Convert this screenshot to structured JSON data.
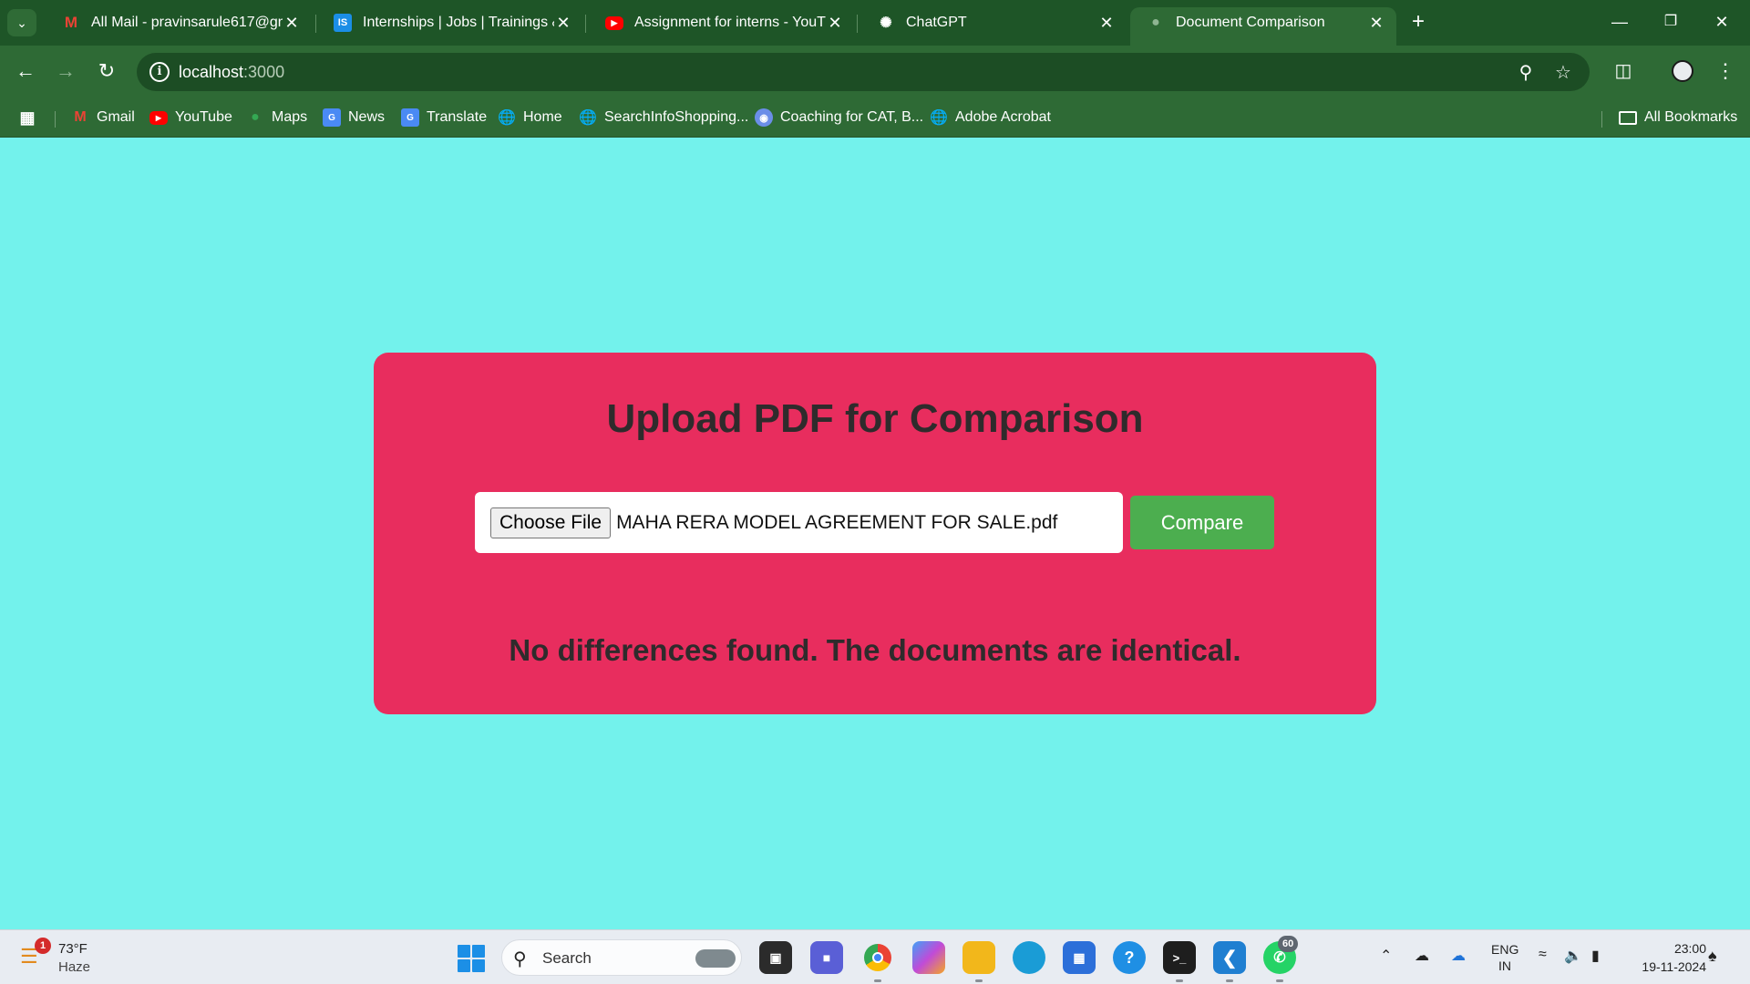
{
  "browser": {
    "tabs": [
      {
        "title": "All Mail - pravinsarule617@gma",
        "favicon": "gmail-icon"
      },
      {
        "title": "Internships | Jobs | Trainings & I",
        "favicon": "internshala-icon"
      },
      {
        "title": "Assignment for interns - YouTub",
        "favicon": "youtube-icon"
      },
      {
        "title": "ChatGPT",
        "favicon": "chatgpt-icon"
      },
      {
        "title": "Document Comparison",
        "favicon": "globe-icon",
        "active": true
      }
    ],
    "address": {
      "host": "localhost",
      "port": ":3000"
    },
    "bookmarks": [
      {
        "label": "Gmail",
        "icon": "gmail-icon"
      },
      {
        "label": "YouTube",
        "icon": "youtube-icon"
      },
      {
        "label": "Maps",
        "icon": "maps-icon"
      },
      {
        "label": "News",
        "icon": "news-icon"
      },
      {
        "label": "Translate",
        "icon": "translate-icon"
      },
      {
        "label": "Home",
        "icon": "globe-icon"
      },
      {
        "label": "SearchInfoShopping...",
        "icon": "globe-icon"
      },
      {
        "label": "Coaching for CAT, B...",
        "icon": "coaching-icon"
      },
      {
        "label": "Adobe Acrobat",
        "icon": "globe-icon"
      }
    ],
    "all_bookmarks": "All Bookmarks"
  },
  "page": {
    "heading": "Upload PDF for Comparison",
    "choose_file_label": "Choose File",
    "file_name": "MAHA RERA MODEL AGREEMENT FOR SALE.pdf",
    "compare_label": "Compare",
    "result": "No differences found. The documents are identical."
  },
  "taskbar": {
    "weather_badge": "1",
    "temperature": "73°F",
    "condition": "Haze",
    "search_label": "Search",
    "whatsapp_badge": "60",
    "lang_top": "ENG",
    "lang_bottom": "IN",
    "time": "23:00",
    "date": "19-11-2024"
  },
  "colors": {
    "page_bg": "#73f2ec",
    "card_bg": "#e82d5e",
    "compare_button": "#4cae4f",
    "browser_frame": "#2e6a35"
  }
}
